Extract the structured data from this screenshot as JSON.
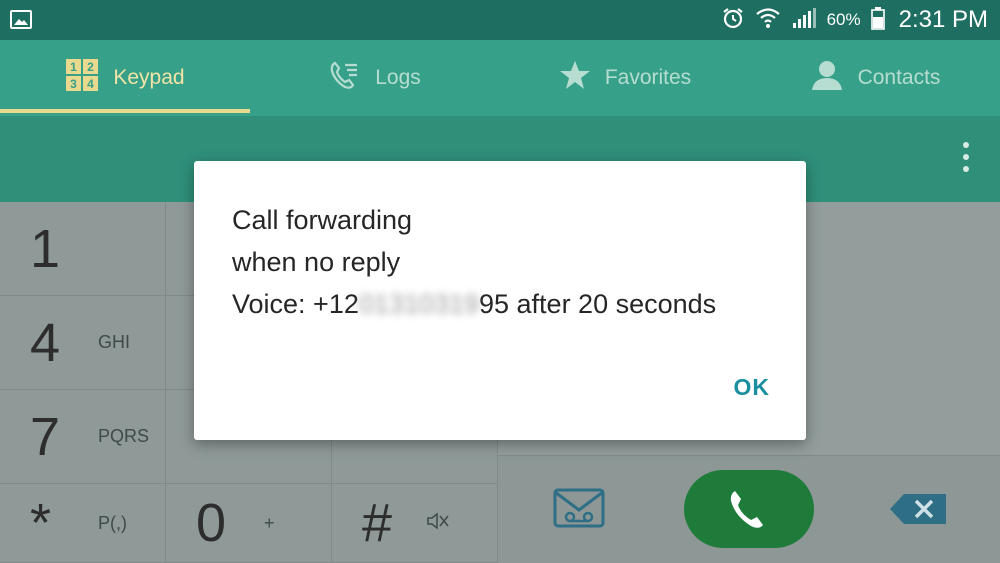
{
  "status_bar": {
    "battery_percent": "60%",
    "time": "2:31 PM",
    "icons": [
      "gallery-icon",
      "alarm-icon",
      "wifi-icon",
      "signal-icon",
      "battery-icon"
    ]
  },
  "tabs": [
    {
      "label": "Keypad",
      "icon": "keypad-icon",
      "active": true
    },
    {
      "label": "Logs",
      "icon": "logs-icon",
      "active": false
    },
    {
      "label": "Favorites",
      "icon": "star-icon",
      "active": false
    },
    {
      "label": "Contacts",
      "icon": "contact-icon",
      "active": false
    }
  ],
  "keypad": {
    "keys": [
      {
        "digit": "1",
        "letters": ""
      },
      {
        "digit": "4",
        "letters": "GHI"
      },
      {
        "digit": "7",
        "letters": "PQRS"
      },
      {
        "digit": "*",
        "letters": "P(,)"
      },
      {
        "digit": "0",
        "letters": "+"
      },
      {
        "digit": "#",
        "letters": ""
      }
    ]
  },
  "dialog": {
    "title_line1": "Call forwarding",
    "title_line2": "when no reply",
    "detail_prefix": "Voice: +12",
    "detail_hidden": "01310319",
    "detail_suffix": "95 after 20 seconds",
    "ok_label": "OK"
  },
  "colors": {
    "status_bar": "#1e6f62",
    "tab_bar": "#36a188",
    "accent_underline": "#e8d98e",
    "call_button": "#1f7b3a",
    "ok_text": "#1a8fa0"
  }
}
